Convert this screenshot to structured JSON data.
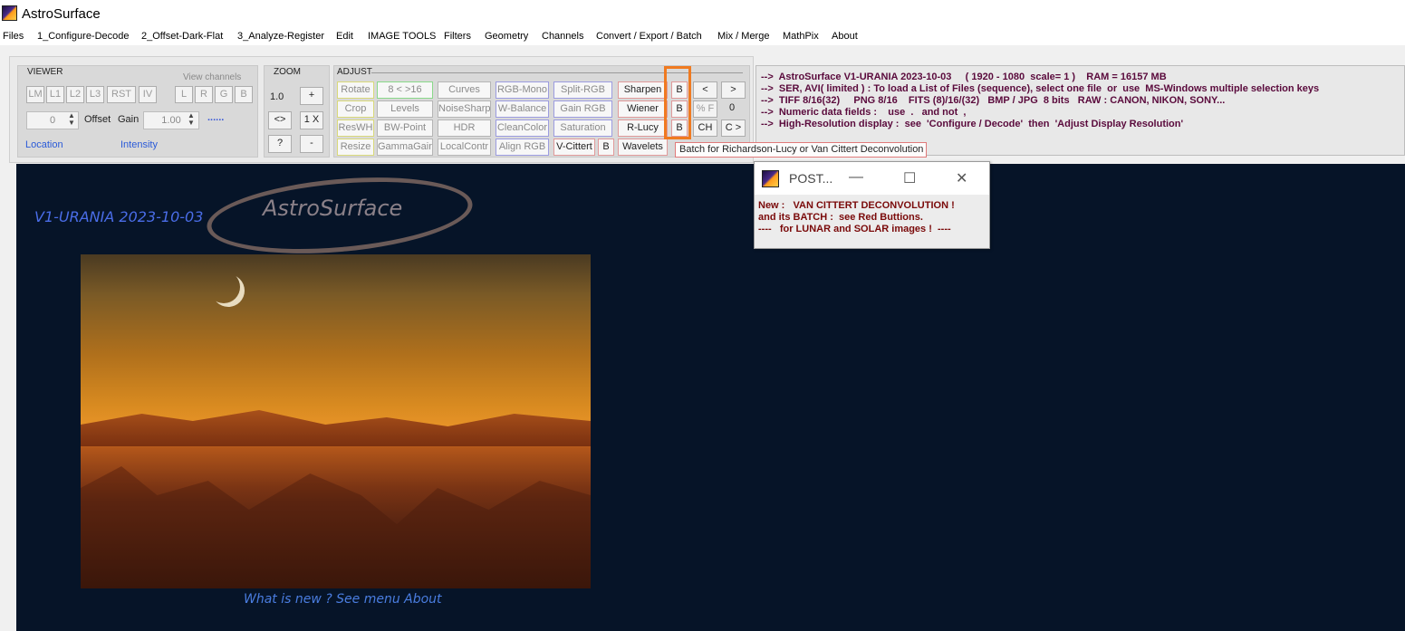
{
  "window": {
    "title": "AstroSurface"
  },
  "menu": [
    "Files",
    "1_Configure-Decode",
    "2_Offset-Dark-Flat",
    "3_Analyze-Register",
    "Edit",
    "IMAGE TOOLS",
    "Filters",
    "Geometry",
    "Channels",
    "Convert / Export / Batch",
    "Mix / Merge",
    "MathPix",
    "About"
  ],
  "viewer": {
    "label": "VIEWER",
    "view_channels_label": "View channels",
    "buttons": [
      "LM",
      "L1",
      "L2",
      "L3",
      "RST",
      "IV"
    ],
    "channel_buttons": [
      "L",
      "R",
      "G",
      "B"
    ],
    "offset_value": "0",
    "offset_label": "Offset",
    "gain_label": "Gain",
    "gain_value": "1.00",
    "dots": "......",
    "location_label": "Location",
    "intensity_label": "Intensity"
  },
  "zoom": {
    "label": "ZOOM",
    "value": "1.0",
    "plus": "+",
    "fit": "<>",
    "one_x": "1 X",
    "help": "?",
    "minus": "-"
  },
  "adjust": {
    "label": "ADJUST",
    "row1": [
      "Rotate",
      "8 < >16",
      "Curves",
      "RGB-Mono",
      "Split-RGB",
      "Sharpen"
    ],
    "row2": [
      "Crop",
      "Levels",
      "NoiseSharp",
      "W-Balance",
      "Gain RGB",
      "Wiener"
    ],
    "row3": [
      "ResWH",
      "BW-Point",
      "HDR",
      "CleanColor",
      "Saturation",
      "R-Lucy"
    ],
    "row4": [
      "Resize",
      "GammaGain",
      "LocalContr",
      "Align RGB",
      "V-Cittert",
      "B",
      "Wavelets"
    ],
    "batch_b": "B",
    "nav_prev": "<",
    "nav_next": ">",
    "percent_f": "% F",
    "counter": "0",
    "ch": "CH",
    "c_next": "C >"
  },
  "info_lines": [
    "-->  AstroSurface V1-URANIA 2023-10-03     ( 1920 - 1080  scale= 1 )    RAM = 16157 MB",
    "-->  SER, AVI( limited ) : To load a List of Files (sequence), select one file  or  use  MS-Windows multiple selection keys",
    "-->  TIFF 8/16(32)     PNG 8/16    FITS (8)/16/(32)   BMP / JPG  8 bits   RAW : CANON, NIKON, SONY...",
    "-->  Numeric data fields :    use  .   and not  ,",
    "-->  High-Resolution display :  see  'Configure / Decode'  then  'Adjust Display Resolution'"
  ],
  "canvas": {
    "version_text": "V1-URANIA 2023-10-03",
    "logo_text": "AstroSurface",
    "caption": "What is new ?  See menu About"
  },
  "tooltip": "Batch for Richardson-Lucy or Van Cittert Deconvolution",
  "post_window": {
    "title": "POST...",
    "minimize": "—",
    "maximize": "☐",
    "close": "✕",
    "lines": [
      "New :   VAN CITTERT DECONVOLUTION !",
      "and its BATCH :  see Red Buttions.",
      "----   for LUNAR and SOLAR images !  ----"
    ]
  },
  "colors": {
    "info_text": "#5a0a3c",
    "post_text": "#7a0a0a",
    "canvas_bg": "#061428",
    "highlight": "#f07a20"
  }
}
